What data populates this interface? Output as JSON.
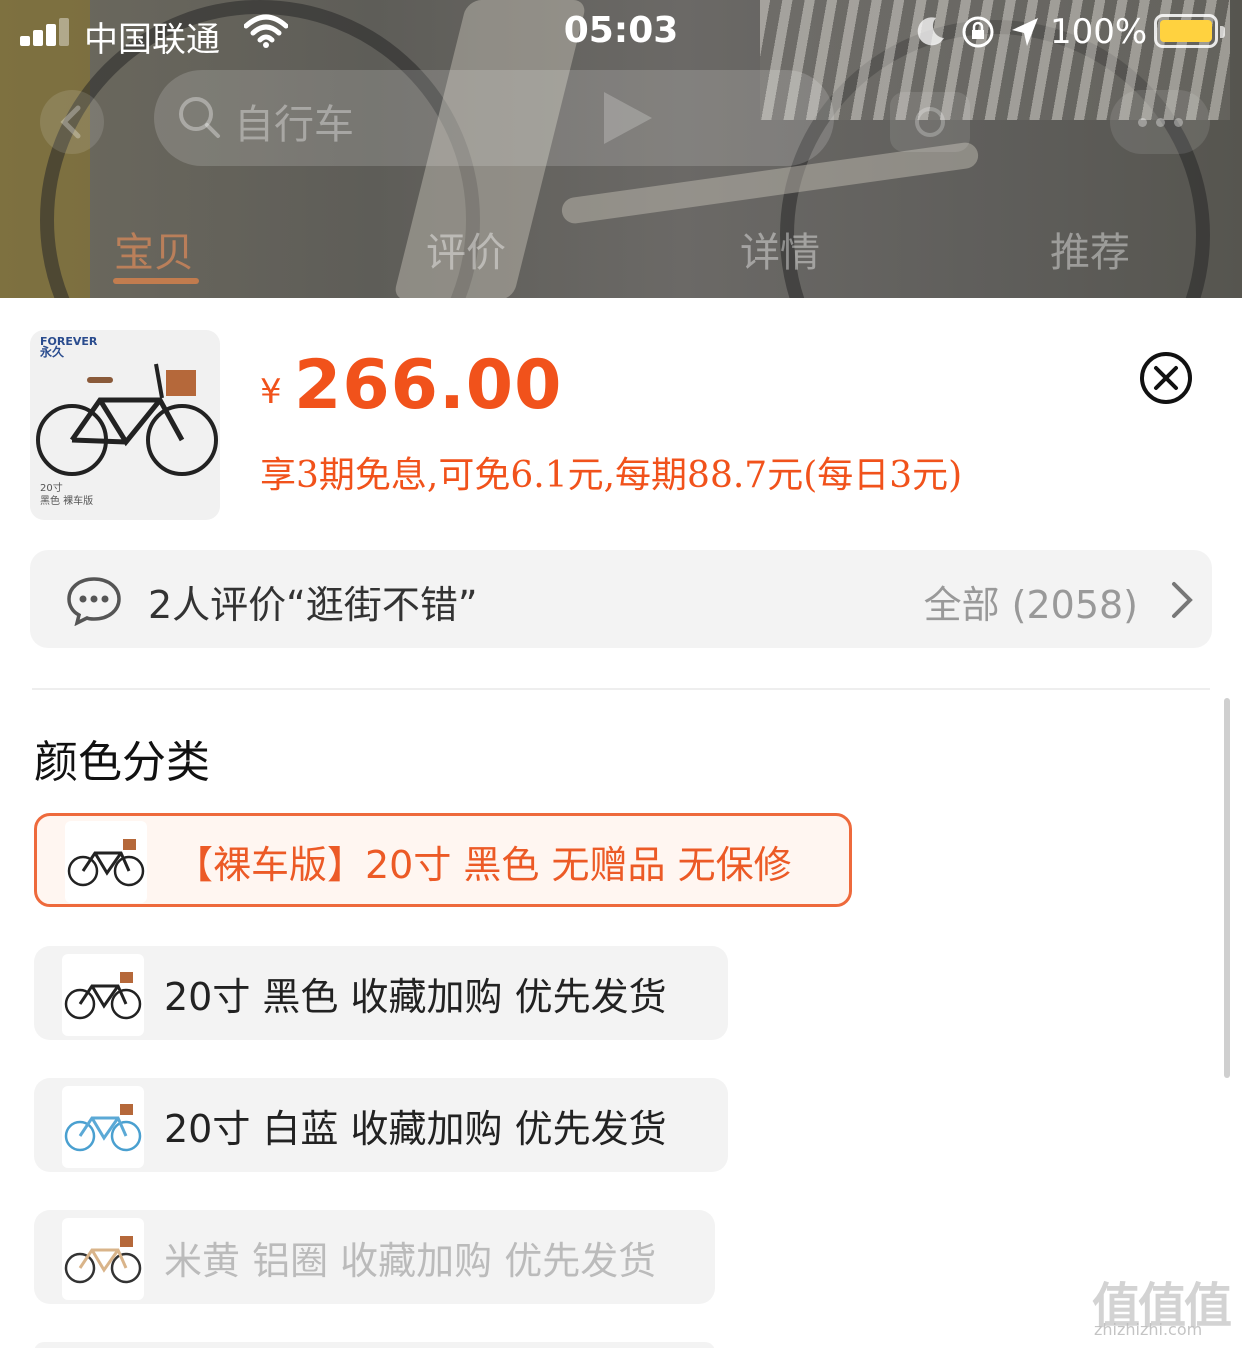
{
  "status_bar": {
    "carrier": "中国联通",
    "time": "05:03",
    "battery": "100%"
  },
  "nav": {
    "search_text": "自行车",
    "tabs": [
      {
        "label": "宝贝",
        "active": true
      },
      {
        "label": "评价",
        "active": false
      },
      {
        "label": "详情",
        "active": false
      },
      {
        "label": "推荐",
        "active": false
      }
    ]
  },
  "product": {
    "thumb_brand": "FOREVER",
    "thumb_brand_cn": "永久",
    "thumb_caption_1": "20寸",
    "thumb_caption_2": "黑色 裸车版",
    "currency": "¥",
    "price": "266.00",
    "installment": "享3期免息,可免6.1元,每期88.7元(每日3元)"
  },
  "reviews": {
    "summary": "2人评价“逛街不错”",
    "all_label": "全部 (2058)"
  },
  "sku": {
    "section_title": "颜色分类",
    "options": [
      {
        "label": "【裸车版】20寸 黑色 无赠品 无保修",
        "state": "selected",
        "frame_color": "#222222"
      },
      {
        "label": "20寸 黑色 收藏加购 优先发货",
        "state": "normal",
        "frame_color": "#222222"
      },
      {
        "label": "20寸 白蓝 收藏加购 优先发货",
        "state": "normal",
        "frame_color": "#5ba9d6"
      },
      {
        "label": "米黄 铝圈 收藏加购 优先发货",
        "state": "disabled",
        "frame_color": "#d9b48a"
      }
    ]
  },
  "colors": {
    "accent": "#f1521b",
    "selected_border": "#ee6a3c"
  },
  "watermark": {
    "main": "值值值",
    "sub": "zhizhizhi.com"
  }
}
